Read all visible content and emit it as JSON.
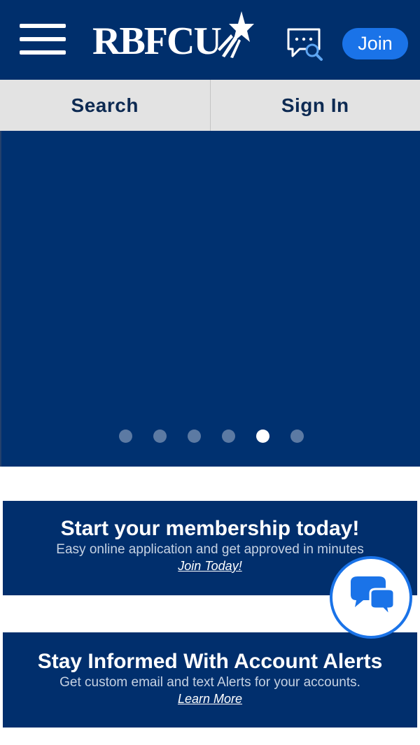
{
  "header": {
    "logo_text": "RBFCU",
    "join_label": "Join"
  },
  "nav": {
    "search_label": "Search",
    "signin_label": "Sign In"
  },
  "carousel": {
    "slide_count": 6,
    "active_index": 4
  },
  "promos": [
    {
      "title": "Start your membership today!",
      "subtitle": "Easy online application and get approved in minutes",
      "link": "Join Today!"
    },
    {
      "title": "Stay Informed With Account Alerts",
      "subtitle": "Get custom email and text Alerts for your accounts.",
      "link": "Learn More"
    }
  ],
  "icons": {
    "menu": "hamburger-menu-icon",
    "chat_search": "chat-search-icon",
    "chat": "chat-bubbles-icon",
    "star": "star-icon"
  },
  "colors": {
    "navy": "#002f6c",
    "accent_blue": "#1a73e8",
    "nav_gray": "#e3e3e3",
    "nav_text": "#0d2a52"
  }
}
